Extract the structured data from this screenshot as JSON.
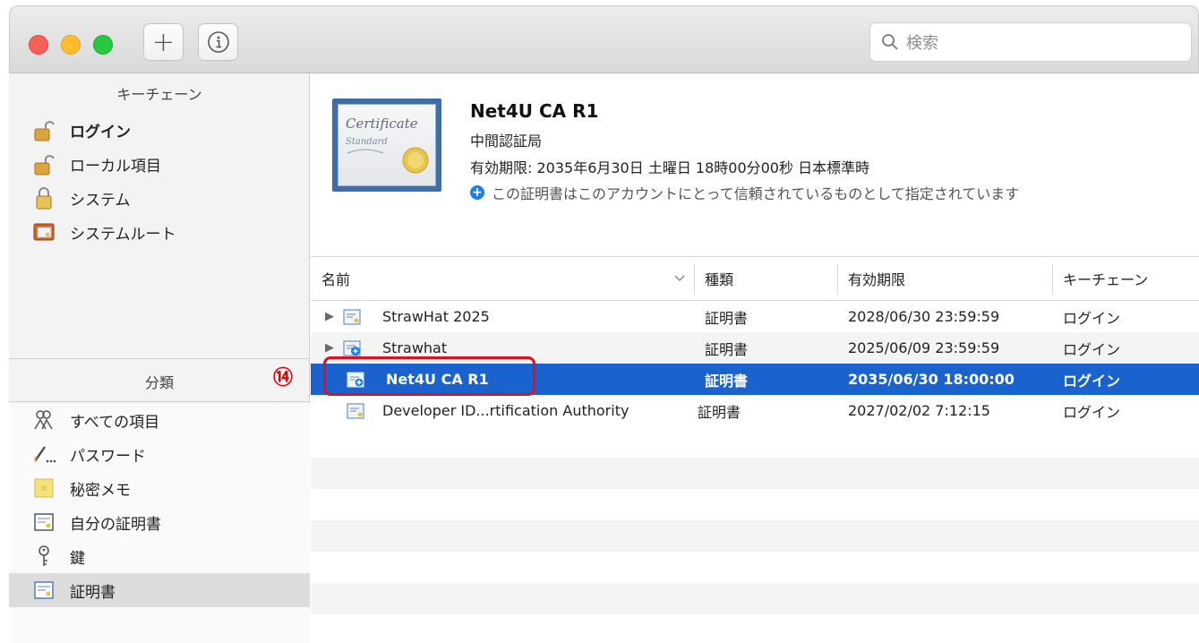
{
  "toolbar": {
    "add_icon": "plus-icon",
    "info_icon": "info-icon",
    "search_placeholder": "検索"
  },
  "sidebar": {
    "keychain_header": "キーチェーン",
    "keychains": [
      {
        "label": "ログイン",
        "icon": "unlocked-padlock-icon"
      },
      {
        "label": "ローカル項目",
        "icon": "unlocked-padlock-icon"
      },
      {
        "label": "システム",
        "icon": "padlock-icon"
      },
      {
        "label": "システムルート",
        "icon": "certificate-folder-icon"
      }
    ],
    "category_header": "分類",
    "categories": [
      {
        "label": "すべての項目",
        "icon": "people-icon"
      },
      {
        "label": "パスワード",
        "icon": "pen-icon"
      },
      {
        "label": "秘密メモ",
        "icon": "note-icon"
      },
      {
        "label": "自分の証明書",
        "icon": "certificate-icon"
      },
      {
        "label": "鍵",
        "icon": "key-icon"
      },
      {
        "label": "証明書",
        "icon": "certificate-icon"
      }
    ]
  },
  "annotation": {
    "step": "⑭"
  },
  "detail": {
    "cert_image_text_1": "Certificate",
    "cert_image_text_2": "Standard",
    "title": "Net4U CA R1",
    "subtitle": "中間認証局",
    "expiry": "有効期限: 2035年6月30日 土曜日 18時00分00秒 日本標準時",
    "trust": "この証明書はこのアカウントにとって信頼されているものとして指定されています"
  },
  "table": {
    "headers": {
      "name": "名前",
      "kind": "種類",
      "expires": "有効期限",
      "keychain": "キーチェーン"
    },
    "rows": [
      {
        "name": "StrawHat 2025",
        "kind": "証明書",
        "expires": "2028/06/30 23:59:59",
        "keychain": "ログイン"
      },
      {
        "name": "Strawhat",
        "kind": "証明書",
        "expires": "2025/06/09 23:59:59",
        "keychain": "ログイン"
      },
      {
        "name": "Net4U CA R1",
        "kind": "証明書",
        "expires": "2035/06/30 18:00:00",
        "keychain": "ログイン"
      },
      {
        "name": "Developer ID...rtification Authority",
        "kind": "証明書",
        "expires": "2027/02/02 7:12:15",
        "keychain": "ログイン"
      }
    ]
  },
  "colors": {
    "selection": "#1a63cf",
    "highlight_box": "#e0101a",
    "step_badge": "#e0000a"
  }
}
